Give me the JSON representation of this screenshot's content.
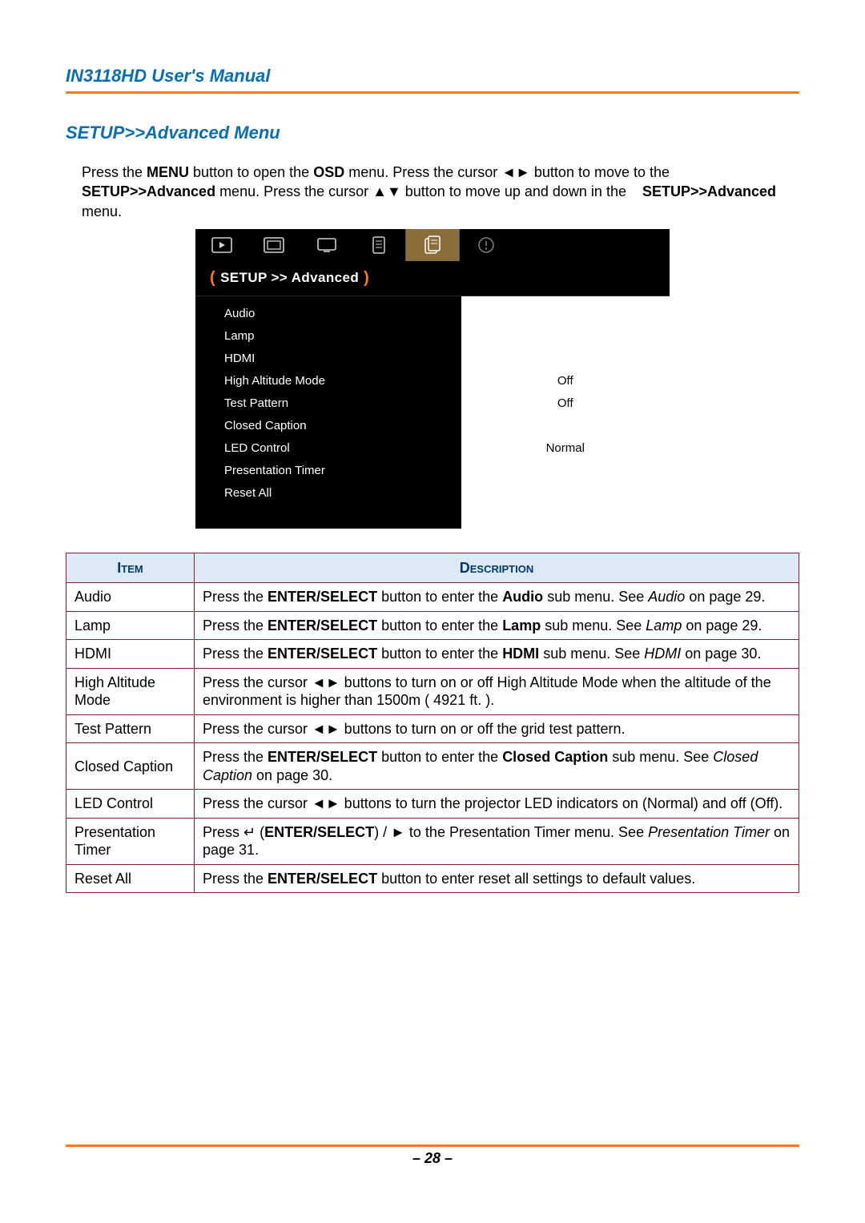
{
  "header": {
    "title": "IN3118HD User's Manual"
  },
  "section": {
    "title": "SETUP>>Advanced Menu"
  },
  "intro": {
    "t1": "Press the ",
    "t2": "MENU",
    "t3": " button to open the ",
    "t4": "OSD",
    "t5": " menu. Press the cursor ◄► button to move to the ",
    "t6": "SETUP>>Advanced",
    "t7": " menu. Press the cursor ▲▼ button to move up and down in the ",
    "t8": "SETUP>>Advanced",
    "t9": " menu."
  },
  "osd": {
    "crumb": "SETUP >> Advanced",
    "items": [
      {
        "label": "Audio",
        "value": ""
      },
      {
        "label": "Lamp",
        "value": ""
      },
      {
        "label": "HDMI",
        "value": ""
      },
      {
        "label": "High Altitude Mode",
        "value": "Off"
      },
      {
        "label": "Test Pattern",
        "value": "Off"
      },
      {
        "label": "Closed Caption",
        "value": ""
      },
      {
        "label": "LED Control",
        "value": "Normal"
      },
      {
        "label": "Presentation Timer",
        "value": ""
      },
      {
        "label": "Reset All",
        "value": ""
      }
    ]
  },
  "table": {
    "headers": {
      "item": "Item",
      "desc": "Description"
    },
    "rows": [
      {
        "item": "Audio",
        "pre": "Press the ",
        "b1": "ENTER/SELECT",
        "mid": " button to enter the ",
        "b2": "Audio",
        "post": " sub menu. See ",
        "i": "Audio",
        "tail": " on page 29."
      },
      {
        "item": "Lamp",
        "pre": "Press the ",
        "b1": "ENTER/SELECT",
        "mid": " button to enter the ",
        "b2": "Lamp",
        "post": " sub menu. See ",
        "i": "Lamp",
        "tail": " on page 29."
      },
      {
        "item": "HDMI",
        "pre": "Press the ",
        "b1": "ENTER/SELECT",
        "mid": " button to enter the ",
        "b2": "HDMI",
        "post": " sub menu. See ",
        "i": "HDMI",
        "tail": " on page 30."
      },
      {
        "item": "High Altitude Mode",
        "plain": "Press the cursor ◄► buttons to turn on or off High Altitude Mode when the altitude of the environment is higher than 1500m ( 4921 ft. )."
      },
      {
        "item": "Test Pattern",
        "plain": "Press the cursor ◄► buttons to turn on or off the grid test pattern."
      },
      {
        "item": "Closed Caption",
        "pre": "Press the ",
        "b1": "ENTER/SELECT",
        "mid": " button to enter the ",
        "b2": "Closed Caption",
        "post": " sub menu. See ",
        "i": "Closed Caption",
        "tail": " on page 30."
      },
      {
        "item": "LED Control",
        "plain": "Press the cursor ◄► buttons to turn the projector LED indicators on (Normal) and off (Off)."
      },
      {
        "item": "Presentation Timer",
        "ptpre": "Press ↵ (",
        "ptb": "ENTER/SELECT",
        "ptmid": ") / ► to the Presentation Timer menu. See ",
        "pti": "Presentation Timer",
        "pttail": " on page 31."
      },
      {
        "item": "Reset All",
        "pre2": "Press the ",
        "b1b": "ENTER/SELECT",
        "tail2": " button to enter reset all settings to default values."
      }
    ]
  },
  "footer": {
    "page": "– 28 –"
  }
}
